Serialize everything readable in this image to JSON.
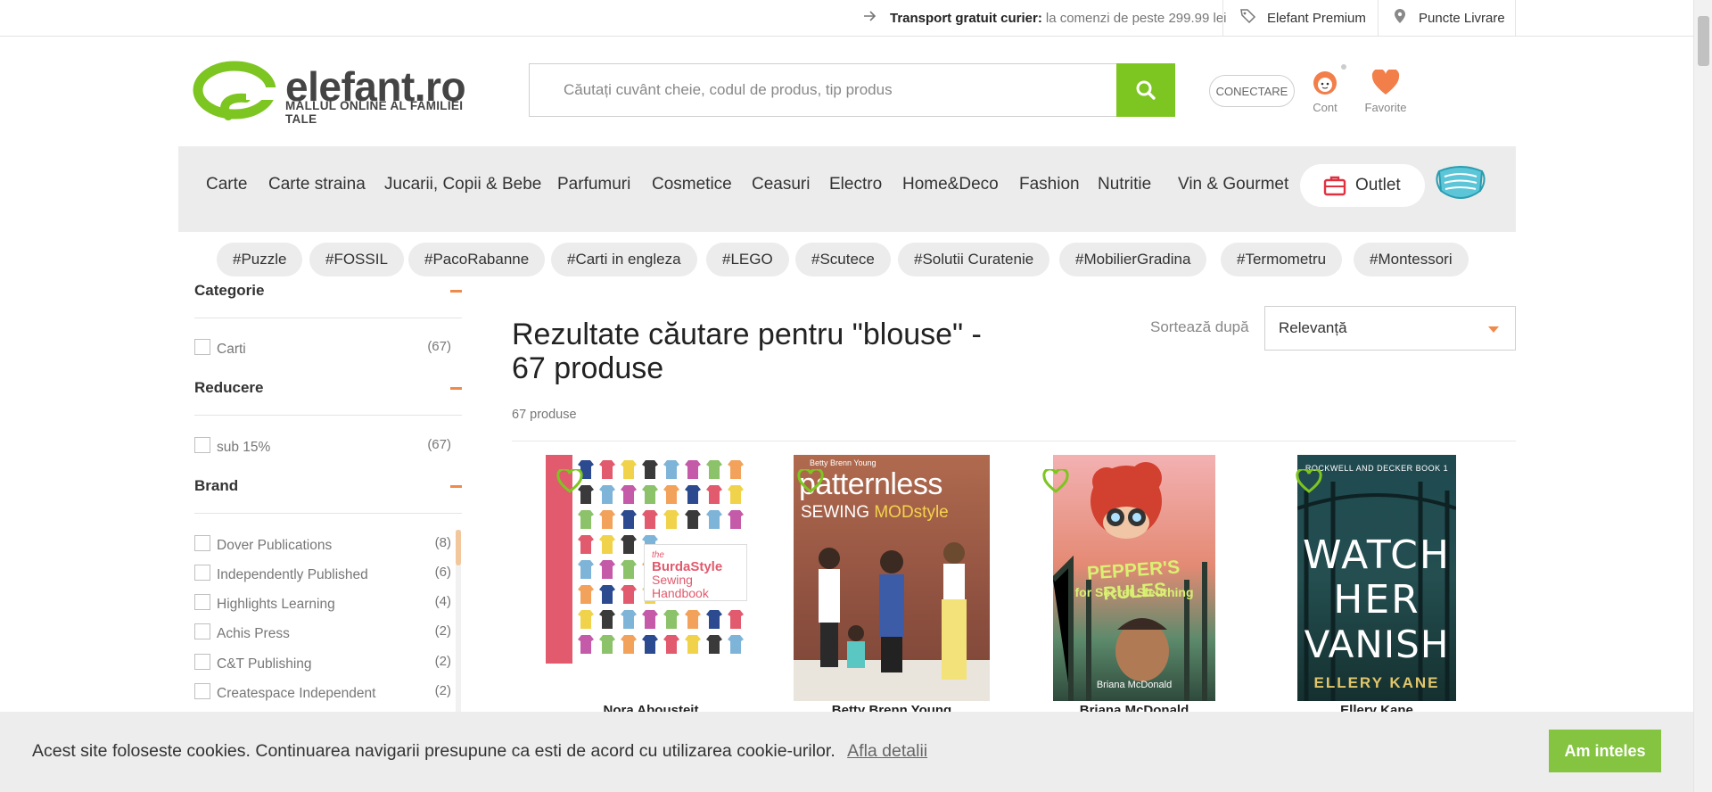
{
  "topbar": {
    "shipping_bold": "Transport gratuit curier:",
    "shipping_rest": "la comenzi de peste 299.99 lei",
    "premium": "Elefant Premium",
    "pickup": "Puncte Livrare"
  },
  "header": {
    "logo_text": "elefant.ro",
    "logo_tagline": "MALLUL ONLINE AL FAMILIEI TALE",
    "search_placeholder": "Căutați cuvânt cheie, codul de produs, tip produs",
    "login": "CONECTARE",
    "account": "Cont",
    "favorites": "Favorite"
  },
  "nav": {
    "items": [
      "Carte",
      "Carte straina",
      "Jucarii, Copii & Bebe",
      "Parfumuri",
      "Cosmetice",
      "Ceasuri",
      "Electro",
      "Home&Deco",
      "Fashion",
      "Nutritie",
      "Vin & Gourmet"
    ],
    "outlet": "Outlet"
  },
  "tags": [
    "#Puzzle",
    "#FOSSIL",
    "#PacoRabanne",
    "#Carti in engleza",
    "#LEGO",
    "#Scutece",
    "#Solutii Curatenie",
    "#MobilierGradina",
    "#Termometru",
    "#Montessori"
  ],
  "sidebar": {
    "category": {
      "title": "Categorie",
      "items": [
        {
          "name": "Carti",
          "count": "(67)"
        }
      ]
    },
    "discount": {
      "title": "Reducere",
      "items": [
        {
          "name": "sub 15%",
          "count": "(67)"
        }
      ]
    },
    "brand": {
      "title": "Brand",
      "items": [
        {
          "name": "Dover Publications",
          "count": "(8)"
        },
        {
          "name": "Independently Published",
          "count": "(6)"
        },
        {
          "name": "Highlights Learning",
          "count": "(4)"
        },
        {
          "name": "Achis Press",
          "count": "(2)"
        },
        {
          "name": "C&T Publishing",
          "count": "(2)"
        },
        {
          "name": "Createspace Independent",
          "count": "(2)"
        }
      ]
    }
  },
  "results": {
    "title": "Rezultate căutare pentru \"blouse\" - 67 produse",
    "count": "67 produse",
    "sort_label": "Sortează după",
    "sort_value": "Relevanță"
  },
  "products": [
    {
      "author": "Nora Abousteit",
      "cover_text": [
        "the",
        "BurdaStyle",
        "Sewing",
        "Handbook"
      ]
    },
    {
      "author": "Betty Brenn Young",
      "cover_text": [
        "Betty Brenn Young",
        "patternless",
        "SEWING",
        "MODstyle"
      ]
    },
    {
      "author": "Briana McDonald",
      "cover_text": [
        "PEPPER'S RULES",
        "for Secret Sleuthing",
        "Briana McDonald"
      ]
    },
    {
      "author": "Ellery Kane",
      "cover_text": [
        "ROCKWELL AND DECKER BOOK 1",
        "WATCH",
        "HER",
        "VANISH",
        "ELLERY KANE"
      ]
    }
  ],
  "cookie": {
    "message": "Acest site foloseste cookies. Continuarea navigarii presupune ca esti de acord cu utilizarea cookie-urilor.",
    "link": "Afla detalii",
    "accept": "Am inteles"
  },
  "colors": {
    "brand_green": "#7dc520",
    "accent_orange": "#f08a4b",
    "heart": "#7dc520"
  }
}
